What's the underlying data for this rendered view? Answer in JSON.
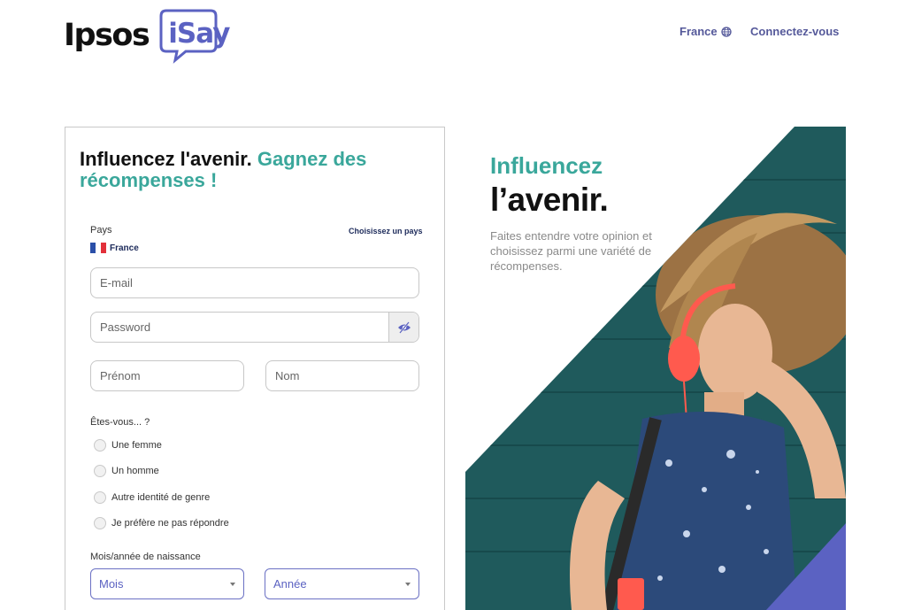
{
  "header": {
    "logo_main": "Ipsos",
    "logo_sub": "iSay",
    "country_label": "France",
    "country_icon": "globe-icon",
    "login_label": "Connectez-vous"
  },
  "form": {
    "title_part1": "Influencez l'avenir.",
    "title_part2": "Gagnez des récompenses !",
    "country_field_label": "Pays",
    "choose_country_link": "Choisissez un pays",
    "country_value": "France",
    "email_placeholder": "E-mail",
    "password_placeholder": "Password",
    "firstname_placeholder": "Prénom",
    "lastname_placeholder": "Nom",
    "gender_question": "Êtes-vous... ?",
    "gender_options": [
      "Une femme",
      "Un homme",
      "Autre identité de genre",
      "Je préfère ne pas répondre"
    ],
    "birth_label": "Mois/année de naissance",
    "month_placeholder": "Mois",
    "year_placeholder": "Année"
  },
  "hero": {
    "title_line1": "Influencez",
    "title_line2": "l’avenir.",
    "description": "Faites entendre votre opinion et choisissez parmi une variété de récompenses."
  },
  "colors": {
    "accent_teal": "#3aa79b",
    "brand_purple": "#5b62c2",
    "nav_text": "#55599a",
    "hero_background_teal": "#1f5a5c"
  }
}
